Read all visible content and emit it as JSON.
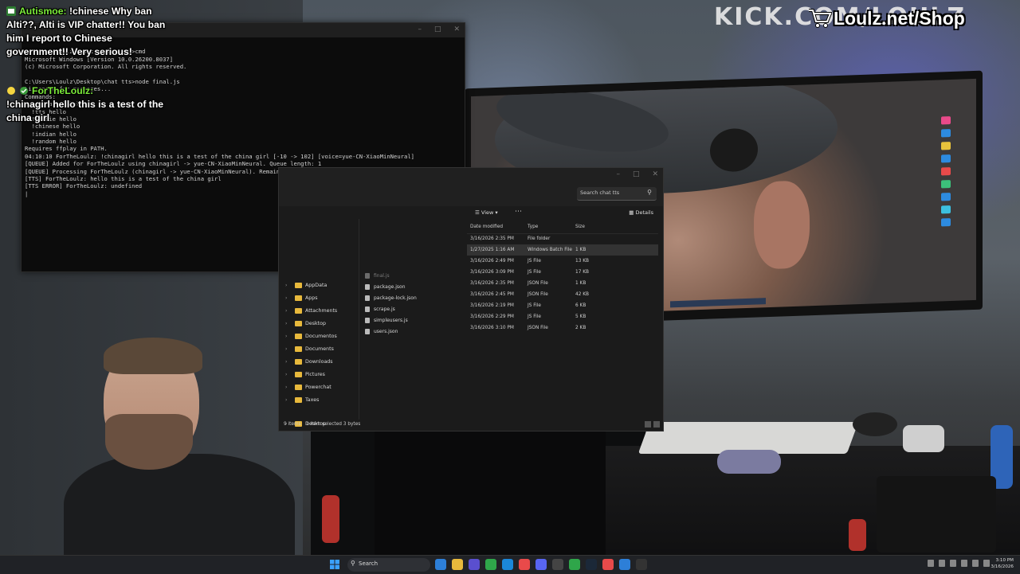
{
  "chat": {
    "messages": [
      {
        "user": "Autismoe:",
        "text": "!chinese Why ban Alti??, Alti is VIP chatter!! You ban him I report to Chinese government!! Very serious!"
      },
      {
        "user": "ForTheLoulz:",
        "text": "!chinagirl hello this is a test of the china girl"
      }
    ]
  },
  "banner": {
    "kick": "KICK.COM/LOULZ",
    "shop": "Loulz.net/Shop"
  },
  "terminal": {
    "lines": [
      "                     ",
      "C:\\Users\\Loulz\\Desktop\\chat tts>cmd",
      "Microsoft Windows [Version 10.0.26200.8037]",
      "(c) Microsoft Corporation. All rights reserved.",
      "",
      "C:\\Users\\Loulz\\Desktop\\chat tts>node final.js",
      "Listening for messages...",
      "Commands:",
      "  !chinagirl hello",
      "  !tts hello",
      "  !aussie hello",
      "  !chinese hello",
      "  !indian hello",
      "  !random hello",
      "Requires ffplay in PATH.",
      "04:10:10 ForTheLoulz: !chinagirl hello this is a test of the china girl [-10 -> 102] [voice=yue-CN-XiaoMinNeural]",
      "[QUEUE] Added for ForTheLoulz using chinagirl -> yue-CN-XiaoMinNeural. Queue length: 1",
      "[QUEUE] Processing ForTheLoulz (chinagirl -> yue-CN-XiaoMinNeural). Remaining: 0",
      "[TTS] ForTheLoulz: hello this is a test of the china girl",
      "[TTS ERROR] ForTheLoulz: undefined",
      "|"
    ]
  },
  "explorer": {
    "search_placeholder": "Search chat tts",
    "view_label": "View",
    "details_label": "Details",
    "columns": {
      "date": "Date modified",
      "type": "Type",
      "size": "Size"
    },
    "nav": [
      "AppData",
      "Apps",
      "Attachments",
      "Desktop",
      "Documentos",
      "Documents",
      "Downloads",
      "Pictures",
      "Powerchat",
      "Taxes",
      "Desktop"
    ],
    "files": [
      "final.js",
      "package.json",
      "package-lock.json",
      "scrape.js",
      "simpleusers.js",
      "users.json"
    ],
    "rows": [
      {
        "date": "3/16/2026 2:35 PM",
        "type": "File folder",
        "size": ""
      },
      {
        "date": "1/27/2025 1:16 AM",
        "type": "Windows Batch File",
        "size": "1 KB"
      },
      {
        "date": "3/16/2026 2:49 PM",
        "type": "JS File",
        "size": "13 KB"
      },
      {
        "date": "3/16/2026 3:09 PM",
        "type": "JS File",
        "size": "17 KB"
      },
      {
        "date": "3/16/2026 2:35 PM",
        "type": "JSON File",
        "size": "1 KB"
      },
      {
        "date": "3/16/2026 2:45 PM",
        "type": "JSON File",
        "size": "42 KB"
      },
      {
        "date": "3/16/2026 2:19 PM",
        "type": "JS File",
        "size": "6 KB"
      },
      {
        "date": "3/16/2026 2:29 PM",
        "type": "JS File",
        "size": "5 KB"
      },
      {
        "date": "3/16/2026 3:10 PM",
        "type": "JSON File",
        "size": "2 KB"
      }
    ],
    "status_items": "9 items",
    "status_selected": "1 item selected  3 bytes"
  },
  "taskbar": {
    "search": "Search",
    "time": "3:10 PM",
    "date": "3/16/2026"
  },
  "colors": {
    "chat_user": "#7bea3a",
    "folder": "#e8b93c",
    "terminal_bg": "#0c0c0c"
  }
}
